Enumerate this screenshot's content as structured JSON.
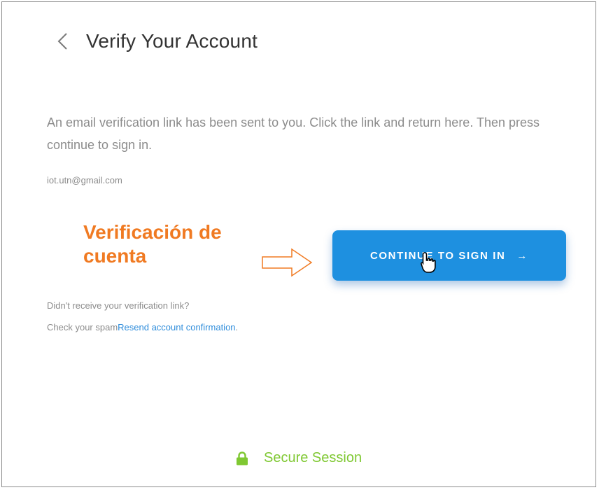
{
  "header": {
    "back_icon": "chevron-left-icon",
    "title": "Verify Your Account"
  },
  "message": {
    "body": "An email verification link has been sent to you. Click the link and return here. Then press continue to sign in.",
    "email": "iot.utn@gmail.com"
  },
  "annotation": {
    "line1": "Verificación de",
    "line2": "cuenta",
    "color": "#f07a22",
    "arrow_icon": "outline-right-arrow-icon"
  },
  "cta": {
    "label": "CONTINUE TO SIGN IN",
    "arrow": "→",
    "color": "#1e90e0"
  },
  "help": {
    "didnt_receive": "Didn't receive your verification link?",
    "check_spam": "Check your spam",
    "resend_link": "Resend account confirmation",
    "period": "."
  },
  "footer": {
    "secure_label": "Secure Session",
    "lock_icon": "lock-icon",
    "color": "#7fc832"
  }
}
